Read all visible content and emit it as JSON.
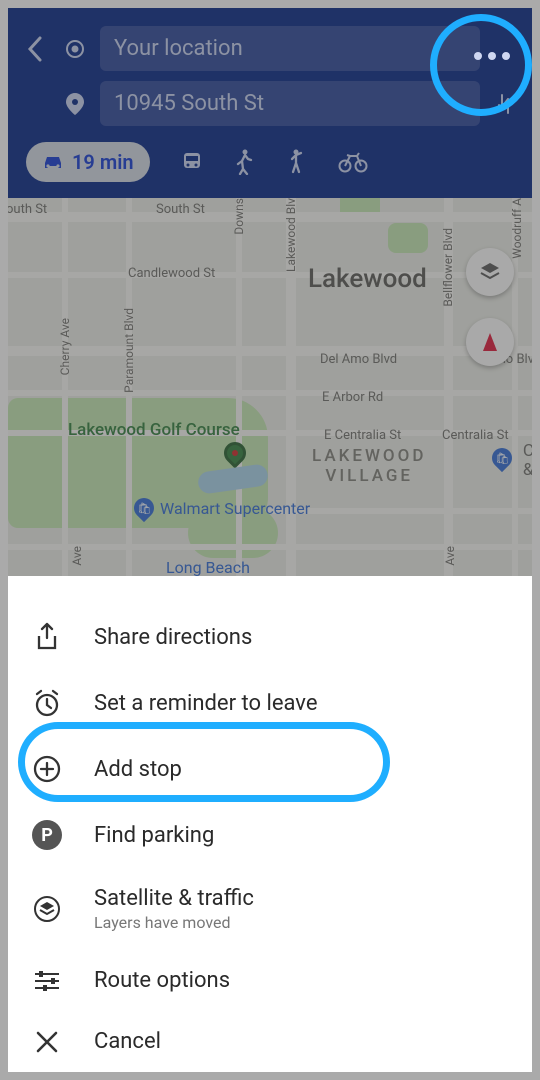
{
  "header": {
    "origin": "Your location",
    "destination": "10945 South St",
    "travel_time": "19 min"
  },
  "map": {
    "city": "Lakewood",
    "village": "LAKEWOOD\nVILLAGE",
    "golf": "Lakewood Golf Course",
    "walmart": "Walmart Supercenter",
    "longbeach": "Long Beach",
    "roads": {
      "south_st_left": "outh St",
      "south_st": "South St",
      "downs": "Downs",
      "lakewood_blv": "Lakewood Blv",
      "candlewood": "Candlewood St",
      "cherry": "Cherry Ave",
      "paramount": "Paramount Blvd",
      "bellflower": "Bellflower Blvd",
      "woodruff": "Woodruff A",
      "delamo": "Del Amo Blvd",
      "amo_blv": "Amo Blv",
      "earbor": "E Arbor Rd",
      "centralia": "E Centralia St",
      "centralia2": "Centralia St",
      "cand": "C\n&",
      "ave1": "Ave",
      "ave2": "Ave"
    }
  },
  "menu": {
    "share": "Share directions",
    "reminder": "Set a reminder to leave",
    "add_stop": "Add stop",
    "parking": "Find parking",
    "satellite": "Satellite & traffic",
    "satellite_sub": "Layers have moved",
    "route": "Route options",
    "cancel": "Cancel"
  }
}
